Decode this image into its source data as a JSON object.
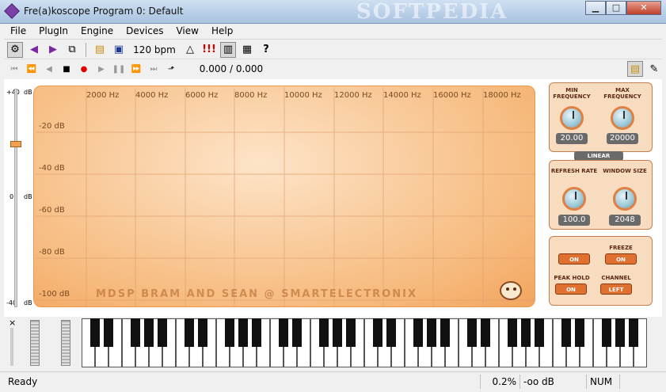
{
  "window": {
    "title": "Fre(a)koscope Program 0: Default",
    "watermark": "SOFTPEDIA"
  },
  "menu": [
    "File",
    "PlugIn",
    "Engine",
    "Devices",
    "View",
    "Help"
  ],
  "toolbar": {
    "bpm": "120 bpm",
    "alert": "!!!",
    "help": "?"
  },
  "transport": {
    "time": "0.000 / 0.000"
  },
  "slider": {
    "top": "+40",
    "top_unit": "dB",
    "mid": "0",
    "mid_unit": "dB",
    "bot": "-40",
    "bot_unit": "dB"
  },
  "display": {
    "freq_labels": [
      "2000 Hz",
      "4000 Hz",
      "6000 Hz",
      "8000 Hz",
      "10000 Hz",
      "12000 Hz",
      "14000 Hz",
      "16000 Hz",
      "18000 Hz"
    ],
    "db_labels": [
      "-20 dB",
      "-40 dB",
      "-60 dB",
      "-80 dB",
      "-100 dB"
    ],
    "credits": "MDSP BRAM AND SEAN @ SMARTELECTRONIX"
  },
  "controls": {
    "min_freq": {
      "label": "MIN FREQUENCY",
      "value": "20.00"
    },
    "max_freq": {
      "label": "MAX FREQUENCY",
      "value": "20000"
    },
    "scale": "LINEAR",
    "refresh": {
      "label": "REFRESH RATE",
      "value": "100.0"
    },
    "window": {
      "label": "WINDOW SIZE",
      "value": "2048"
    },
    "freeze": {
      "label": "FREEZE",
      "value": "ON"
    },
    "peak_hold": {
      "label": "PEAK HOLD",
      "value": "ON"
    },
    "channel": {
      "label": "CHANNEL",
      "value": "LEFT"
    },
    "unlabeled_toggle": "ON"
  },
  "keyboard": {
    "close": "×"
  },
  "status": {
    "text": "Ready",
    "cpu": "0.2%",
    "level": "-oo dB",
    "num": "NUM"
  }
}
